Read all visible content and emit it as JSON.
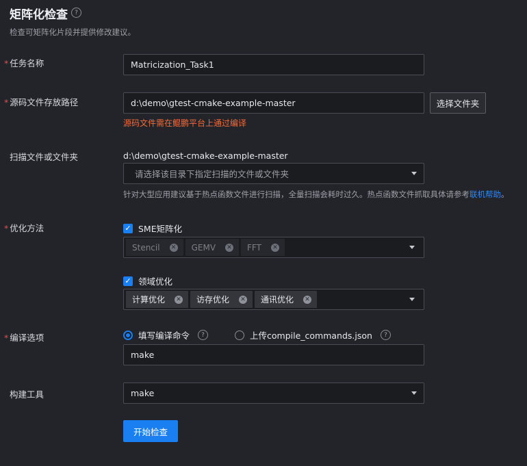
{
  "header": {
    "title": "矩阵化检查",
    "subtitle": "检查可矩阵化片段并提供修改建议。"
  },
  "form": {
    "task_name": {
      "label": "任务名称",
      "value": "Matricization_Task1"
    },
    "source_path": {
      "label": "源码文件存放路径",
      "value": "d:\\demo\\gtest-cmake-example-master",
      "button": "选择文件夹",
      "error": "源码文件需在鲲鹏平台上通过编译"
    },
    "scan": {
      "label": "扫描文件或文件夹",
      "path": "d:\\demo\\gtest-cmake-example-master",
      "placeholder": "请选择该目录下指定扫描的文件或文件夹",
      "hint": "针对大型应用建议基于热点函数文件进行扫描，全量扫描会耗时过久。热点函数文件抓取具体请参考",
      "link": "联机帮助",
      "hint_end": "。"
    },
    "optimization": {
      "label": "优化方法",
      "sme": {
        "label": "SME矩阵化",
        "checked": true,
        "tags": [
          "Stencil",
          "GEMV",
          "FFT"
        ]
      },
      "domain": {
        "label": "领域优化",
        "checked": true,
        "tags": [
          "计算优化",
          "访存优化",
          "通讯优化"
        ]
      }
    },
    "compile": {
      "label": "编译选项",
      "option1": "填写编译命令",
      "option2": "上传compile_commands.json",
      "selected": "填写编译命令",
      "value": "make"
    },
    "build_tool": {
      "label": "构建工具",
      "value": "make"
    },
    "submit": "开始检查"
  },
  "colors": {
    "accent": "#1a7ff0",
    "error": "#f26b3a",
    "required": "#e34d59",
    "background": "#232429"
  }
}
